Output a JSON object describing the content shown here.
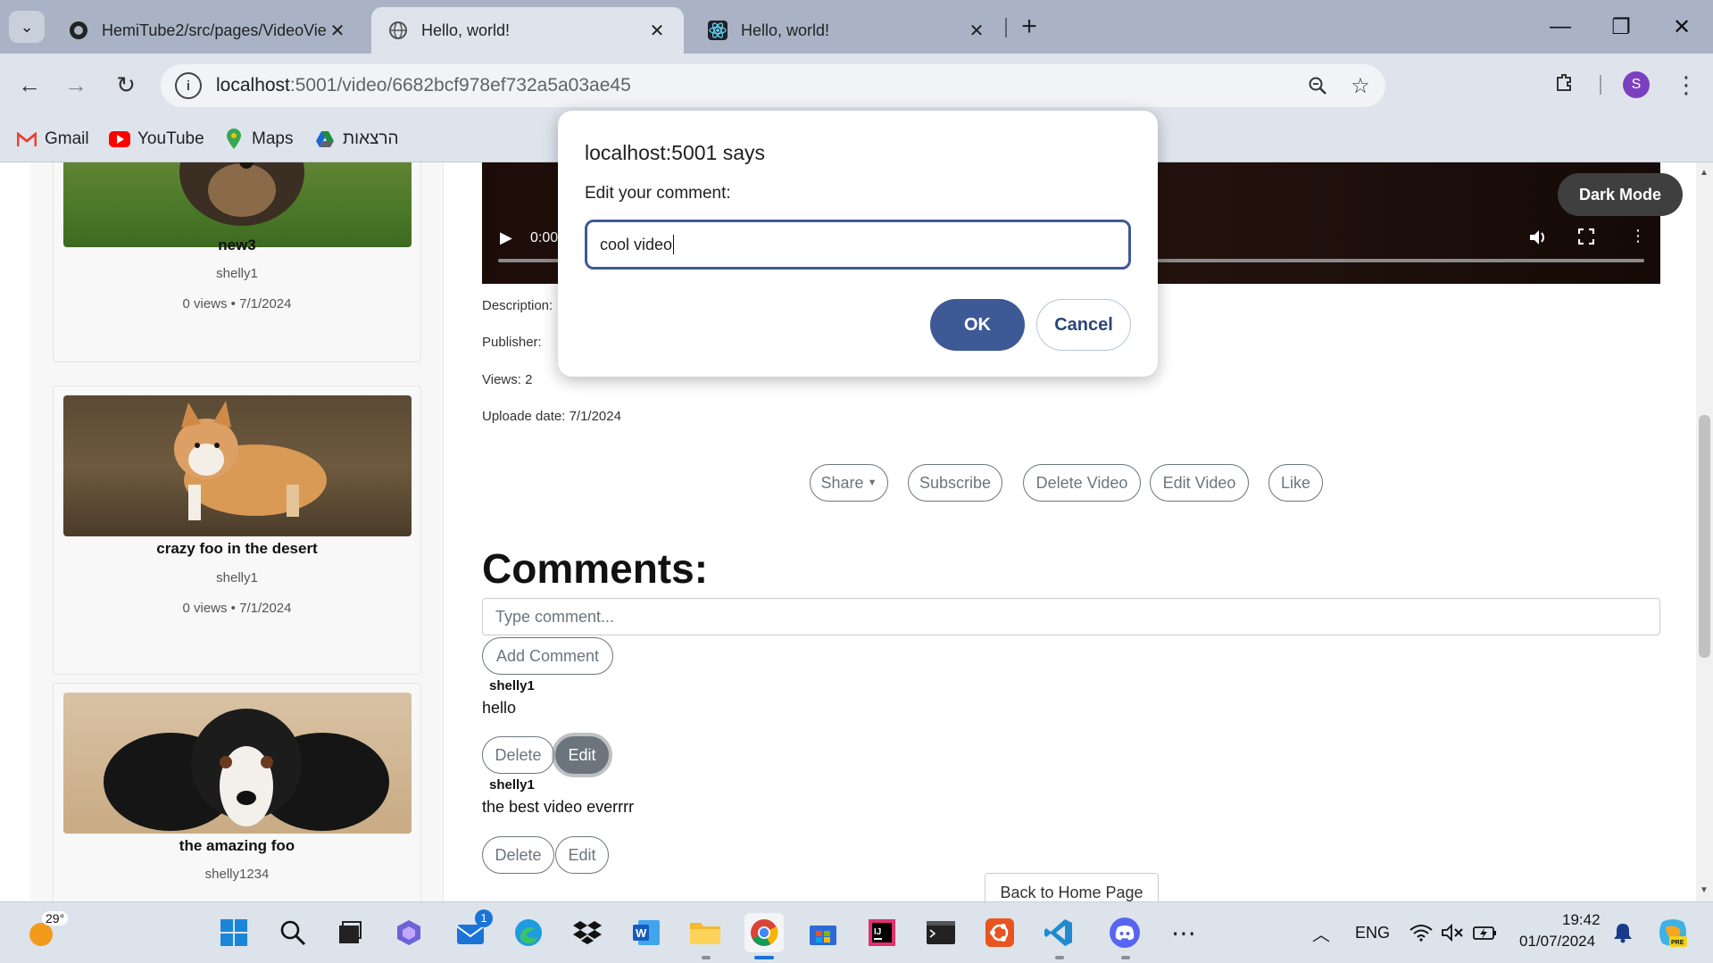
{
  "browser": {
    "tabs": [
      {
        "title": "HemiTube2/src/pages/VideoVie",
        "icon": "github-icon"
      },
      {
        "title": "Hello, world!",
        "icon": "globe-icon"
      },
      {
        "title": "Hello, world!",
        "icon": "react-icon"
      }
    ],
    "url_host": "localhost",
    "url_path": ":5001/video/6682bcf978ef732a5a03ae45",
    "profile_initial": "S",
    "bookmarks": [
      "Gmail",
      "YouTube",
      "Maps",
      "הרצאות"
    ]
  },
  "sidebar": {
    "cards": [
      {
        "title": "new3",
        "author": "shelly1",
        "meta": "0 views • 7/1/2024"
      },
      {
        "title": "crazy foo in the desert",
        "author": "shelly1",
        "meta": "0 views • 7/1/2024"
      },
      {
        "title": "the amazing foo",
        "author": "shelly1234",
        "meta": ""
      }
    ]
  },
  "video": {
    "time": "0:00",
    "description_label": "Description:",
    "publisher_label": "Publisher:",
    "views": "Views: 2",
    "upload_date": "Uploade date: 7/1/2024"
  },
  "dark_mode_label": "Dark Mode",
  "actions": {
    "share": "Share",
    "subscribe": "Subscribe",
    "delete_video": "Delete Video",
    "edit_video": "Edit Video",
    "like": "Like"
  },
  "comments": {
    "heading": "Comments:",
    "input_placeholder": "Type comment...",
    "add_label": "Add Comment",
    "items": [
      {
        "user": "shelly1",
        "text": "hello",
        "delete": "Delete",
        "edit": "Edit"
      },
      {
        "user": "shelly1",
        "text": "the best video everrrr",
        "delete": "Delete",
        "edit": "Edit"
      }
    ],
    "back_home": "Back to Home Page"
  },
  "dialog": {
    "title": "localhost:5001 says",
    "message": "Edit your comment:",
    "value": "cool video",
    "ok": "OK",
    "cancel": "Cancel"
  },
  "taskbar": {
    "weather_temp": "29°",
    "mail_badge": "1",
    "language": "ENG",
    "time": "19:42",
    "date": "01/07/2024"
  }
}
